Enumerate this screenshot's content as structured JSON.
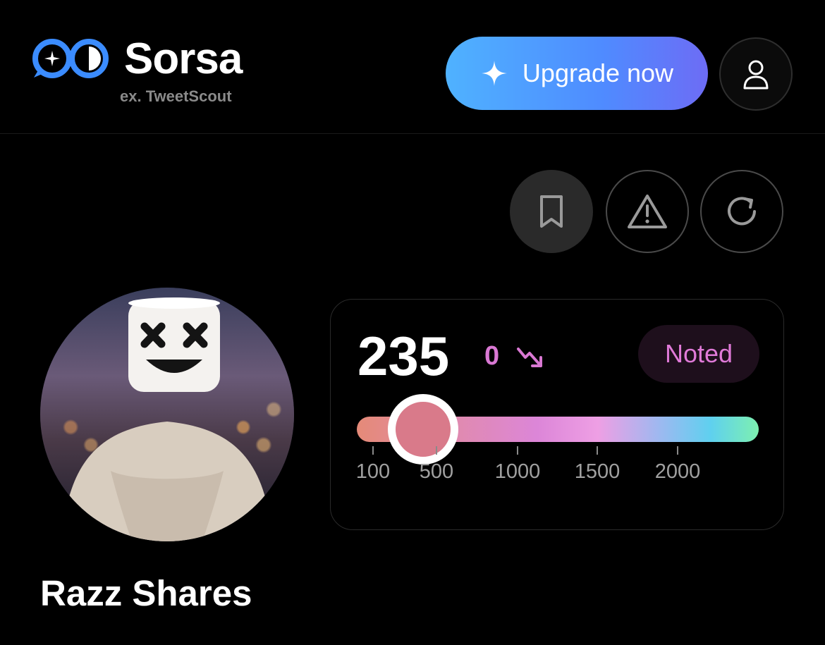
{
  "header": {
    "brand_name": "Sorsa",
    "brand_sub": "ex. TweetScout",
    "upgrade_label": "Upgrade now",
    "upgrade_icon": "sparkle-icon",
    "account_icon": "user-icon"
  },
  "actions": [
    {
      "name": "bookmark",
      "icon": "bookmark-icon"
    },
    {
      "name": "report",
      "icon": "warning-icon"
    },
    {
      "name": "refresh",
      "icon": "refresh-icon"
    }
  ],
  "profile": {
    "display_name": "Razz Shares",
    "avatar_description": "marshmello-head-avatar"
  },
  "score_card": {
    "score": "235",
    "delta": "0",
    "trend_icon": "trend-down-icon",
    "badge": "Noted",
    "slider_value": 235,
    "ticks": [
      "100",
      "500",
      "1000",
      "1500",
      "2000"
    ]
  },
  "colors": {
    "background": "#000000",
    "accent": "#d978d3",
    "upgrade_gradient_start": "#4fb2ff",
    "upgrade_gradient_end": "#6d6cf5"
  }
}
